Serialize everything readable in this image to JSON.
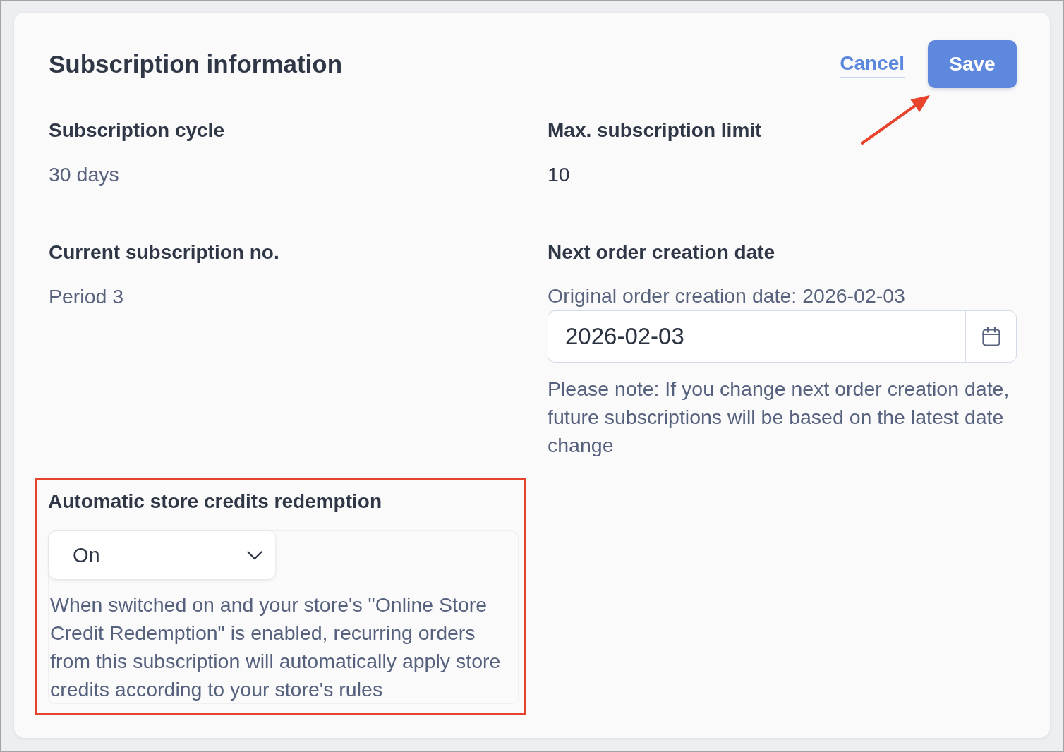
{
  "panel": {
    "title": "Subscription information",
    "actions": [
      {
        "kind": "link",
        "label": "Cancel"
      },
      {
        "kind": "primary",
        "label": "Save"
      }
    ]
  },
  "fields": [
    {
      "kind": "text",
      "label": "Subscription cycle",
      "value": "30 days",
      "muted": true,
      "highlighted": false
    },
    {
      "kind": "text",
      "label": "Max. subscription limit",
      "value": "10",
      "muted": false,
      "highlighted": false
    },
    {
      "kind": "text",
      "label": "Current subscription no.",
      "value": "Period 3",
      "muted": true,
      "highlighted": false
    },
    {
      "kind": "date",
      "label": "Next order creation date",
      "caption": "Original order creation date: 2026-02-03",
      "value": "2026-02-03",
      "note": "Please note: If you change next order creation date, future subscriptions will be based on the latest date change",
      "highlighted": false
    },
    {
      "kind": "select",
      "label": "Automatic store credits redemption",
      "value": "On",
      "description": "When switched on and your store's \"Online Store Credit Redemption\" is enabled, recurring orders from this subscription will automatically apply store credits according to your store's rules",
      "highlighted": true
    }
  ]
}
